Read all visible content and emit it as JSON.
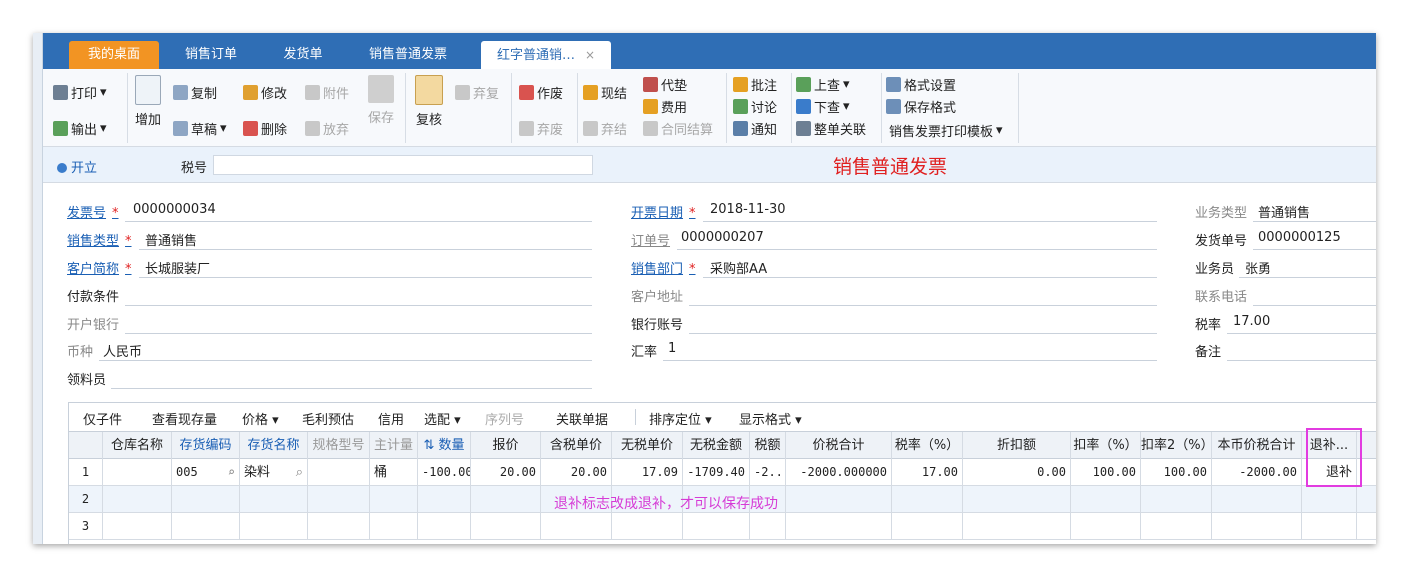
{
  "tabs": [
    {
      "label": "我的桌面"
    },
    {
      "label": "销售订单"
    },
    {
      "label": "发货单"
    },
    {
      "label": "销售普通发票"
    },
    {
      "label": "红字普通销…",
      "close": "×"
    }
  ],
  "toolbar": {
    "print": "打印",
    "export": "输出",
    "add": "增加",
    "copy": "复制",
    "draft": "草稿",
    "edit": "修改",
    "attach": "附件",
    "delete": "删除",
    "abandon": "放弃",
    "save": "保存",
    "review": "复核",
    "resume": "弃复",
    "void": "作废",
    "discard": "弃废",
    "cash": "现结",
    "abandon_settle": "弃结",
    "advance": "代垫",
    "fee": "费用",
    "contract_settle": "合同结算",
    "annotate": "批注",
    "discuss": "讨论",
    "notify": "通知",
    "prev": "上查",
    "next": "下查",
    "link_all": "整单关联",
    "format_settings": "格式设置",
    "save_format": "保存格式",
    "print_template": "销售发票打印模板"
  },
  "subbar": {
    "status": "开立",
    "tax_label": "税号",
    "title": "销售普通发票"
  },
  "form": {
    "invoice_no_label": "发票号",
    "invoice_no": "0000000034",
    "sale_type_label": "销售类型",
    "sale_type": "普通销售",
    "customer_label": "客户简称",
    "customer": "长城服装厂",
    "payment_label": "付款条件",
    "bank_label": "开户银行",
    "currency_label": "币种",
    "currency": "人民币",
    "picker_label": "领料员",
    "date_label": "开票日期",
    "date": "2018-11-30",
    "order_no_label": "订单号",
    "order_no": "0000000207",
    "dept_label": "销售部门",
    "dept": "采购部AA",
    "address_label": "客户地址",
    "account_label": "银行账号",
    "rate_label": "汇率",
    "rate": "1",
    "biz_type_label": "业务类型",
    "biz_type": "普通销售",
    "ship_no_label": "发货单号",
    "ship_no": "0000000125",
    "clerk_label": "业务员",
    "clerk": "张勇",
    "phone_label": "联系电话",
    "tax_rate_label": "税率",
    "tax_rate": "17.00",
    "remark_label": "备注"
  },
  "grid_toolbar": {
    "sub": "仅子件",
    "stock": "查看现存量",
    "price": "价格",
    "margin": "毛利预估",
    "credit": "信用",
    "pick": "选配",
    "serial": "序列号",
    "link": "关联单据",
    "sort": "排序定位",
    "display": "显示格式"
  },
  "grid": {
    "headers": [
      "",
      "仓库名称",
      "存货编码",
      "存货名称",
      "规格型号",
      "主计量",
      "数量",
      "报价",
      "含税单价",
      "无税单价",
      "无税金额",
      "税额",
      "价税合计",
      "税率（%）",
      "折扣额",
      "扣率（%）",
      "扣率2（%）",
      "本币价税合计",
      "退补..."
    ],
    "rows": [
      [
        "1",
        "",
        "005",
        "染料",
        "",
        "桶",
        "-100.00",
        "20.00",
        "20.00",
        "17.09",
        "-1709.40",
        "-2...",
        "-2000.000000",
        "17.00",
        "0.00",
        "100.00",
        "100.00",
        "-2000.00",
        "退补"
      ],
      [
        "2",
        "",
        "",
        "",
        "",
        "",
        "",
        "",
        "",
        "",
        "",
        "",
        "",
        "",
        "",
        "",
        "",
        "",
        ""
      ],
      [
        "3",
        "",
        "",
        "",
        "",
        "",
        "",
        "",
        "",
        "",
        "",
        "",
        "",
        "",
        "",
        "",
        "",
        "",
        ""
      ]
    ]
  },
  "annotation": "退补标志改成退补，才可以保存成功",
  "colors": {
    "tabbar": "#2f6eb5",
    "home_tab": "#f29423",
    "title_red": "#e02020",
    "link_blue": "#1a5fb4",
    "highlight": "#e23be0"
  }
}
